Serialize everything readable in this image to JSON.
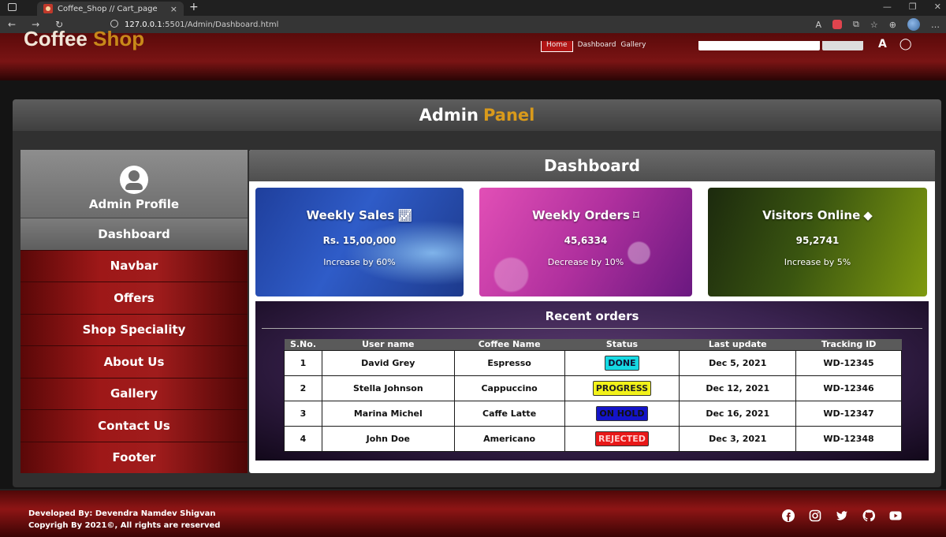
{
  "browser": {
    "tab_title": "Coffee_Shop // Cart_page",
    "tab_close": "×",
    "new_tab": "+",
    "url_host": "127.0.0.1",
    "url_path": ":5501/Admin/Dashboard.html"
  },
  "site": {
    "logo_main": "Coffee",
    "logo_accent": "Shop",
    "nav": [
      "Home",
      "Dashboard",
      "Gallery"
    ]
  },
  "admin_panel": {
    "title_main": "Admin",
    "title_accent": "Panel"
  },
  "sidebar": {
    "profile_label": "Admin Profile",
    "items": [
      {
        "label": "Dashboard",
        "active": true
      },
      {
        "label": "Navbar"
      },
      {
        "label": "Offers"
      },
      {
        "label": "Shop Speciality"
      },
      {
        "label": "About Us"
      },
      {
        "label": "Gallery"
      },
      {
        "label": "Contact Us"
      },
      {
        "label": "Footer"
      }
    ]
  },
  "dashboard": {
    "title": "Dashboard",
    "cards": [
      {
        "title": "Weekly Sales",
        "value": "Rs. 15,00,000",
        "sub": "Increase by 60%",
        "icon": "chart-line-icon"
      },
      {
        "title": "Weekly Orders",
        "value": "45,6334",
        "sub": "Decrease by 10%",
        "icon": "bookmark-icon"
      },
      {
        "title": "Visitors Online",
        "value": "95,2741",
        "sub": "Increase by 5%",
        "icon": "diamond-icon"
      }
    ],
    "orders": {
      "title": "Recent orders",
      "headers": [
        "S.No.",
        "User name",
        "Coffee Name",
        "Status",
        "Last update",
        "Tracking ID"
      ],
      "rows": [
        {
          "sno": "1",
          "user": "David Grey",
          "coffee": "Espresso",
          "status": "DONE",
          "updated": "Dec 5, 2021",
          "tracking": "WD-12345"
        },
        {
          "sno": "2",
          "user": "Stella Johnson",
          "coffee": "Cappuccino",
          "status": "PROGRESS",
          "updated": "Dec 12, 2021",
          "tracking": "WD-12346"
        },
        {
          "sno": "3",
          "user": "Marina Michel",
          "coffee": "Caffe Latte",
          "status": "ON HOLD",
          "updated": "Dec 16, 2021",
          "tracking": "WD-12347"
        },
        {
          "sno": "4",
          "user": "John Doe",
          "coffee": "Americano",
          "status": "REJECTED",
          "updated": "Dec 3, 2021",
          "tracking": "WD-12348"
        }
      ]
    }
  },
  "footer": {
    "developer": "Developed By: Devendra Namdev Shigvan",
    "copyright": "Copyrigh By 2021©, All rights are reserved",
    "social": [
      "facebook-icon",
      "instagram-icon",
      "twitter-icon",
      "github-icon",
      "youtube-icon"
    ]
  },
  "colors": {
    "accent": "#d99a1b",
    "sidebar_red": "#9e1818",
    "done": "#16d9e3",
    "progress": "#f2f21a",
    "on_hold": "#1414c8",
    "rejected": "#e81818"
  }
}
